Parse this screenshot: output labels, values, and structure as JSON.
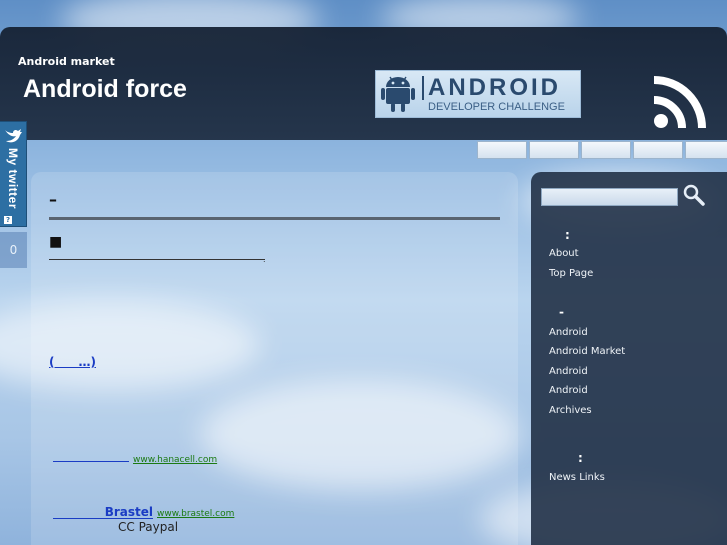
{
  "header": {
    "subtitle": "Android market",
    "title": "Android force",
    "banner": {
      "word": "ANDROID",
      "sub": "DEVELOPER CHALLENGE"
    }
  },
  "twitter_tab": {
    "label": "My twitter",
    "help": "?"
  },
  "counter": "0",
  "main": {
    "title": "–",
    "bullet": "■",
    "more_link": "(　　…)",
    "ads": [
      {
        "name": "",
        "url": "www.hanacell.com"
      },
      {
        "name": "Brastel",
        "url": "www.brastel.com",
        "desc": "CC Paypal"
      }
    ]
  },
  "sidebar": {
    "widget1": {
      "head": ":",
      "links": [
        "About",
        "Top Page"
      ]
    },
    "widget2": {
      "head": "-",
      "links": [
        "Android",
        "Android Market",
        "Android",
        "Android",
        "Archives"
      ]
    },
    "widget3": {
      "head": ":",
      "links": [
        "News Links"
      ]
    }
  },
  "colors": {
    "link": "#1a3cc4",
    "ad_url": "#1b7a12",
    "panel": "#1e2c42",
    "twitter": "#2d6fa3"
  }
}
